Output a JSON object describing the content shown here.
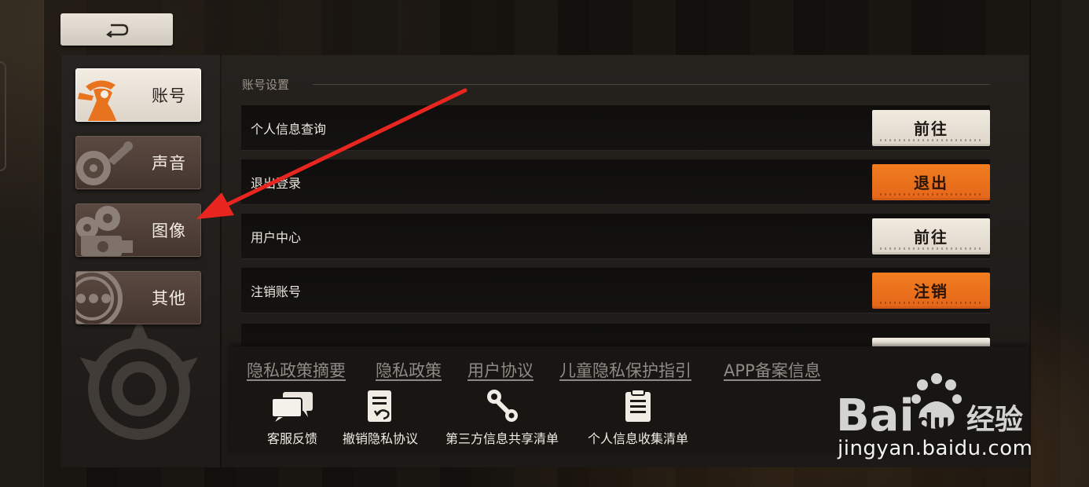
{
  "back_button": {
    "icon": "return-arrow-icon"
  },
  "sidebar": {
    "items": [
      {
        "label": "账号",
        "icon": "account-detective-icon",
        "active": true
      },
      {
        "label": "声音",
        "icon": "gramophone-icon",
        "active": false
      },
      {
        "label": "图像",
        "icon": "film-projector-icon",
        "active": false
      },
      {
        "label": "其他",
        "icon": "more-dots-icon",
        "active": false
      }
    ]
  },
  "main": {
    "section_title": "账号设置",
    "rows": [
      {
        "label": "个人信息查询",
        "button": "前往",
        "style": "light"
      },
      {
        "label": "退出登录",
        "button": "退出",
        "style": "orange"
      },
      {
        "label": "用户中心",
        "button": "前往",
        "style": "light"
      },
      {
        "label": "注销账号",
        "button": "注销",
        "style": "orange"
      }
    ]
  },
  "footer": {
    "links": [
      "隐私政策摘要",
      "隐私政策",
      "用户协议",
      "儿童隐私保护指引",
      "APP备案信息"
    ],
    "tools": [
      {
        "label": "客服反馈",
        "icon": "chat-bubbles-icon"
      },
      {
        "label": "撤销隐私协议",
        "icon": "document-undo-icon"
      },
      {
        "label": "第三方信息共享清单",
        "icon": "key-icon"
      },
      {
        "label": "个人信息收集清单",
        "icon": "clipboard-icon"
      }
    ]
  },
  "colors": {
    "accent_orange": "#ee7420",
    "button_cream": "#ebe4d9",
    "annotation_red": "#e8261f"
  },
  "watermark": {
    "logo": "Bai🐾du经验",
    "url": "jingyan.baidu.com"
  }
}
